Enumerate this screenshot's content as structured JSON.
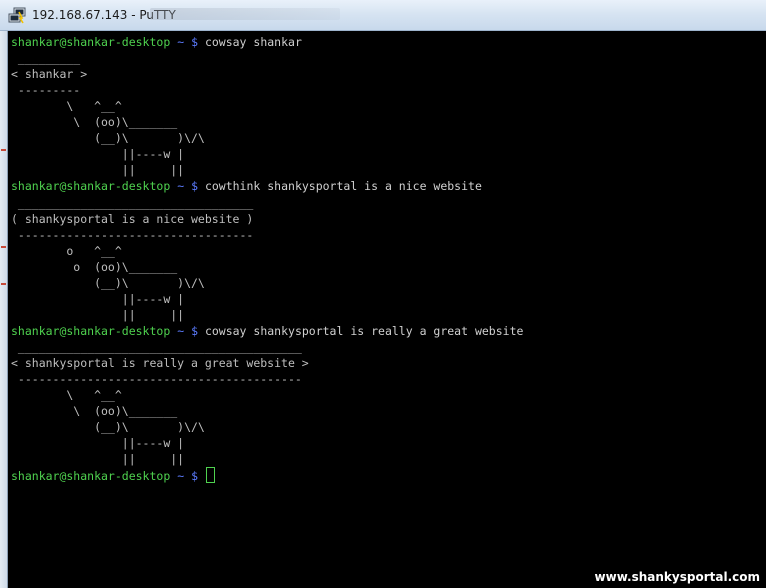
{
  "window": {
    "title": "192.168.67.143 - PuTTY",
    "icon": "putty-app-icon"
  },
  "terminal": {
    "colors": {
      "background": "#000000",
      "prompt": "#4fd24f",
      "path": "#5c7cff",
      "text": "#bfbfbf"
    },
    "prompt": {
      "user_host": "shankar@shankar-desktop",
      "path": "~",
      "symbol": "$"
    },
    "lines": [
      {
        "type": "prompt",
        "command": "cowsay shankar"
      },
      {
        "type": "output",
        "text": " _________"
      },
      {
        "type": "output",
        "text": "< shankar >"
      },
      {
        "type": "output",
        "text": " ---------"
      },
      {
        "type": "output",
        "text": "        \\   ^__^"
      },
      {
        "type": "output",
        "text": "         \\  (oo)\\_______"
      },
      {
        "type": "output",
        "text": "            (__)\\       )\\/\\"
      },
      {
        "type": "output",
        "text": "                ||----w |"
      },
      {
        "type": "output",
        "text": "                ||     ||"
      },
      {
        "type": "prompt",
        "command": "cowthink shankysportal is a nice website"
      },
      {
        "type": "output",
        "text": " __________________________________"
      },
      {
        "type": "output",
        "text": "( shankysportal is a nice website )"
      },
      {
        "type": "output",
        "text": " ----------------------------------"
      },
      {
        "type": "output",
        "text": "        o   ^__^"
      },
      {
        "type": "output",
        "text": "         o  (oo)\\_______"
      },
      {
        "type": "output",
        "text": "            (__)\\       )\\/\\"
      },
      {
        "type": "output",
        "text": "                ||----w |"
      },
      {
        "type": "output",
        "text": "                ||     ||"
      },
      {
        "type": "prompt",
        "command": "cowsay shankysportal is really a great website"
      },
      {
        "type": "output",
        "text": " _________________________________________"
      },
      {
        "type": "output",
        "text": "< shankysportal is really a great website >"
      },
      {
        "type": "output",
        "text": " -----------------------------------------"
      },
      {
        "type": "output",
        "text": "        \\   ^__^"
      },
      {
        "type": "output",
        "text": "         \\  (oo)\\_______"
      },
      {
        "type": "output",
        "text": "            (__)\\       )\\/\\"
      },
      {
        "type": "output",
        "text": "                ||----w |"
      },
      {
        "type": "output",
        "text": "                ||     ||"
      },
      {
        "type": "prompt",
        "command": "",
        "cursor": true
      }
    ]
  },
  "watermark": "www.shankysportal.com"
}
